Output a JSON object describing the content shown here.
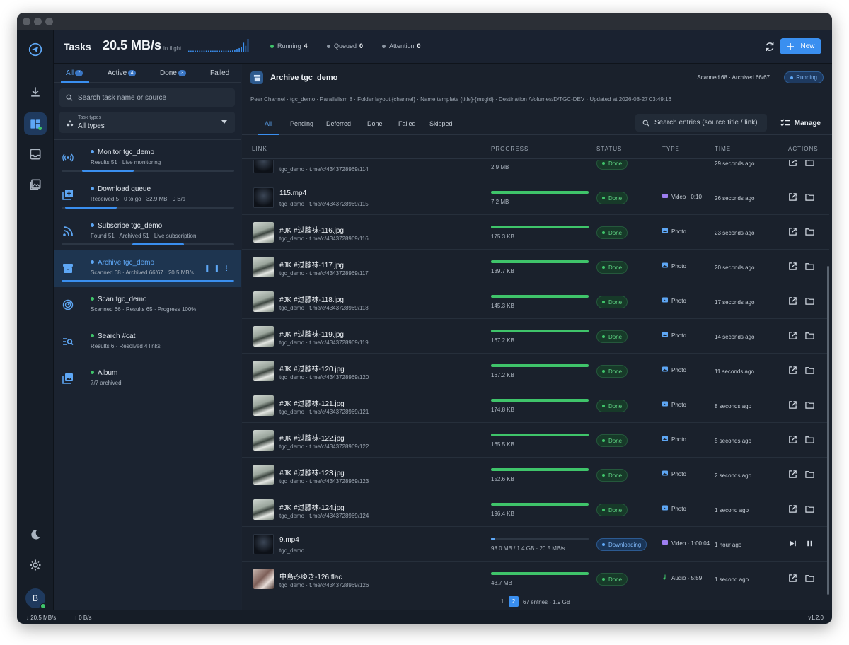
{
  "header": {
    "title": "Tasks",
    "speed": "20.5 MB/s",
    "speed_caption": "in flight",
    "stats": [
      {
        "label": "Running",
        "value": "4",
        "color": "#3fc46a"
      },
      {
        "label": "Queued",
        "value": "0",
        "color": "#8c96a2"
      },
      {
        "label": "Attention",
        "value": "0",
        "color": "#8c96a2"
      }
    ],
    "new_label": "New",
    "accent": "#3a8ff0"
  },
  "sidebar": {
    "tabs": [
      {
        "label": "All",
        "badge": "7"
      },
      {
        "label": "Active",
        "badge": "4"
      },
      {
        "label": "Done",
        "badge": "3"
      },
      {
        "label": "Failed",
        "badge": ""
      }
    ],
    "search_placeholder": "Search task name or source",
    "types_label": "Task types",
    "types_value": "All types",
    "tasks": [
      {
        "icon": "monitor-icon",
        "name": "Monitor tgc_demo",
        "meta": "Results 51  · Live monitoring",
        "dot": "#5ea7f5",
        "progress": 0.3,
        "progress_start": 0.12
      },
      {
        "icon": "download-queue-icon",
        "name": "Download queue",
        "meta": "Received 5 · 0 to go · 32.9 MB · 0 B/s",
        "dot": "#5ea7f5",
        "progress": 0.3,
        "progress_start": 0.02
      },
      {
        "icon": "rss-icon",
        "name": "Subscribe tgc_demo",
        "meta": "Found 51  · Archived 51  · Live subscription",
        "dot": "#5ea7f5",
        "progress": 0.3,
        "progress_start": 0.41
      },
      {
        "icon": "archive-icon",
        "name": "Archive tgc_demo",
        "meta": "Scanned 68  · Archived 66/67  · 20.5 MB/s",
        "dot": "#5ea7f5",
        "progress": 1.0,
        "progress_start": 0.0,
        "selected": true
      },
      {
        "icon": "scan-icon",
        "name": "Scan tgc_demo",
        "meta": "Scanned 66  · Results 65  · Progress 100%",
        "dot": "#3fc46a"
      },
      {
        "icon": "search-link-icon",
        "name": "Search #cat",
        "meta": "Results 6  · Resolved 4 links",
        "dot": "#3fc46a"
      },
      {
        "icon": "album-icon",
        "name": "Album",
        "meta": "7/7 archived",
        "dot": "#3fc46a"
      }
    ]
  },
  "main": {
    "title": "Archive tgc_demo",
    "counts": "Scanned 68 · Archived 66/67",
    "status_badge": "Running",
    "meta": "Peer Channel · tgc_demo · Parallelism 8 · Folder layout {channel} · Name template {title}-{msgid} · Destination /Volumes/D/TGC-DEV · Updated at 2026-08-27 03:49:16",
    "subtabs": [
      "All",
      "Pending",
      "Deferred",
      "Done",
      "Failed",
      "Skipped"
    ],
    "entry_search_placeholder": "Search entries (source title / link)",
    "manage_label": "Manage",
    "columns": [
      "LINK",
      "PROGRESS",
      "STATUS",
      "TYPE",
      "TIME",
      "ACTIONS"
    ],
    "rows": [
      {
        "name": "",
        "link": "tgc_demo · t.me/c/4343728969/114",
        "progress": 1.0,
        "size": "2.9 MB",
        "status": "Done",
        "kind": "done",
        "type": "",
        "time": "29 seconds ago",
        "thumb": "dark"
      },
      {
        "name": "115.mp4",
        "link": "tgc_demo · t.me/c/4343728969/115",
        "progress": 1.0,
        "size": "7.2 MB",
        "status": "Done",
        "kind": "done",
        "type": "Video · 0:10",
        "type_icon": "video-icon",
        "time": "26 seconds ago",
        "thumb": "dark"
      },
      {
        "name": "#JK #过膝袜-116.jpg",
        "link": "tgc_demo · t.me/c/4343728969/116",
        "progress": 1.0,
        "size": "175.3 KB",
        "status": "Done",
        "kind": "done",
        "type": "Photo",
        "type_icon": "photo-icon",
        "time": "23 seconds ago",
        "thumb": "photo"
      },
      {
        "name": "#JK #过膝袜-117.jpg",
        "link": "tgc_demo · t.me/c/4343728969/117",
        "progress": 1.0,
        "size": "139.7 KB",
        "status": "Done",
        "kind": "done",
        "type": "Photo",
        "type_icon": "photo-icon",
        "time": "20 seconds ago",
        "thumb": "photo"
      },
      {
        "name": "#JK #过膝袜-118.jpg",
        "link": "tgc_demo · t.me/c/4343728969/118",
        "progress": 1.0,
        "size": "145.3 KB",
        "status": "Done",
        "kind": "done",
        "type": "Photo",
        "type_icon": "photo-icon",
        "time": "17 seconds ago",
        "thumb": "photo"
      },
      {
        "name": "#JK #过膝袜-119.jpg",
        "link": "tgc_demo · t.me/c/4343728969/119",
        "progress": 1.0,
        "size": "167.2 KB",
        "status": "Done",
        "kind": "done",
        "type": "Photo",
        "type_icon": "photo-icon",
        "time": "14 seconds ago",
        "thumb": "photo"
      },
      {
        "name": "#JK #过膝袜-120.jpg",
        "link": "tgc_demo · t.me/c/4343728969/120",
        "progress": 1.0,
        "size": "167.2 KB",
        "status": "Done",
        "kind": "done",
        "type": "Photo",
        "type_icon": "photo-icon",
        "time": "11 seconds ago",
        "thumb": "photo"
      },
      {
        "name": "#JK #过膝袜-121.jpg",
        "link": "tgc_demo · t.me/c/4343728969/121",
        "progress": 1.0,
        "size": "174.8 KB",
        "status": "Done",
        "kind": "done",
        "type": "Photo",
        "type_icon": "photo-icon",
        "time": "8 seconds ago",
        "thumb": "photo"
      },
      {
        "name": "#JK #过膝袜-122.jpg",
        "link": "tgc_demo · t.me/c/4343728969/122",
        "progress": 1.0,
        "size": "165.5 KB",
        "status": "Done",
        "kind": "done",
        "type": "Photo",
        "type_icon": "photo-icon",
        "time": "5 seconds ago",
        "thumb": "photo"
      },
      {
        "name": "#JK #过膝袜-123.jpg",
        "link": "tgc_demo · t.me/c/4343728969/123",
        "progress": 1.0,
        "size": "152.6 KB",
        "status": "Done",
        "kind": "done",
        "type": "Photo",
        "type_icon": "photo-icon",
        "time": "2 seconds ago",
        "thumb": "photo"
      },
      {
        "name": "#JK #过膝袜-124.jpg",
        "link": "tgc_demo · t.me/c/4343728969/124",
        "progress": 1.0,
        "size": "196.4 KB",
        "status": "Done",
        "kind": "done",
        "type": "Photo",
        "type_icon": "photo-icon",
        "time": "1 second ago",
        "thumb": "photo"
      },
      {
        "name": "9.mp4",
        "link": "tgc_demo",
        "progress": 0.04,
        "size": "98.0 MB / 1.4 GB · 20.5 MB/s",
        "status": "Downloading",
        "kind": "dl",
        "type": "Video · 1:00:04",
        "type_icon": "video-icon",
        "time": "1 hour ago",
        "thumb": "dark"
      },
      {
        "name": "中島みゆき-126.flac",
        "link": "tgc_demo · t.me/c/4343728969/126",
        "progress": 1.0,
        "size": "43.7 MB",
        "status": "Done",
        "kind": "done",
        "type": "Audio · 5:59",
        "type_icon": "audio-icon",
        "time": "1 second ago",
        "thumb": "cover"
      }
    ],
    "pager": {
      "pages": [
        "1",
        "2"
      ],
      "current": "2",
      "summary": "67 entries · 1.9 GB"
    }
  },
  "statusbar": {
    "down": "20.5 MB/s",
    "up": "0 B/s",
    "version": "v1.2.0"
  },
  "user_initial": "B",
  "colors": {
    "done": "#3fc46a",
    "downloading": "#5ea7f5"
  }
}
